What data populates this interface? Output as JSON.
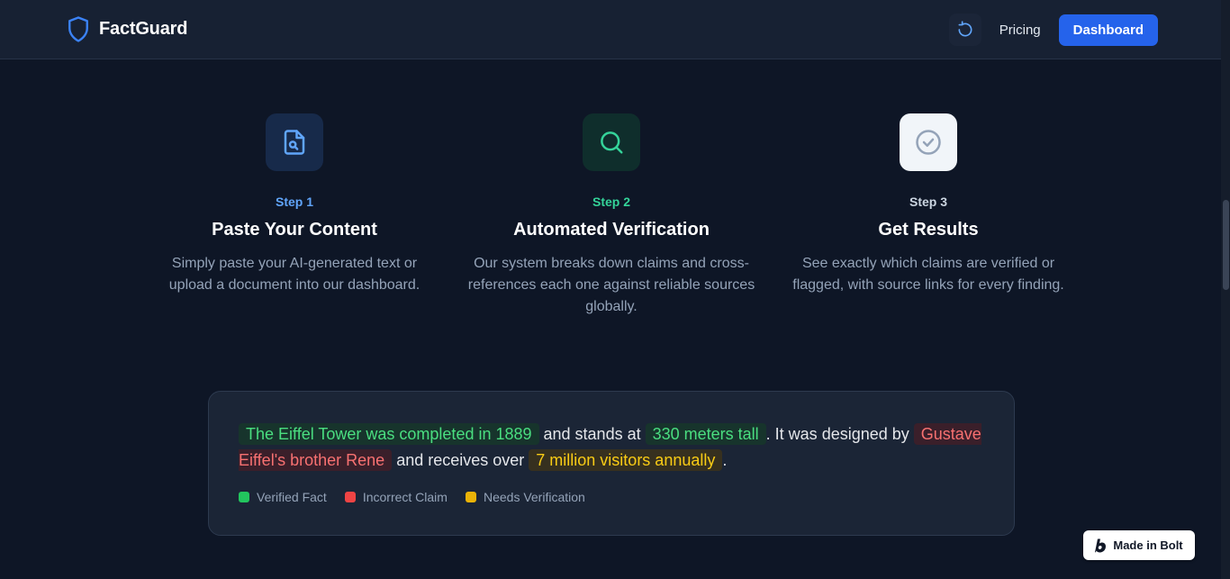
{
  "header": {
    "brand": "FactGuard",
    "pricing_label": "Pricing",
    "dashboard_label": "Dashboard"
  },
  "steps": [
    {
      "num": "Step 1",
      "title": "Paste Your Content",
      "desc": "Simply paste your AI-generated text or upload a document into our dashboard.",
      "icon": "file-search-icon",
      "accent": "#60a5fa"
    },
    {
      "num": "Step 2",
      "title": "Automated Verification",
      "desc": "Our system breaks down claims and cross-references each one against reliable sources globally.",
      "icon": "search-icon",
      "accent": "#34d399"
    },
    {
      "num": "Step 3",
      "title": "Get Results",
      "desc": "See exactly which claims are verified or flagged, with source links for every finding.",
      "icon": "check-circle-icon",
      "accent": "#cbd5e1"
    }
  ],
  "demo": {
    "seg1": "The Eiffel Tower was completed in 1889",
    "seg2": " and stands at ",
    "seg3": "330 meters tall",
    "seg4": ". It was designed by ",
    "seg5": "Gustave Eiffel's brother Rene",
    "seg6": " and receives over ",
    "seg7": "7 million visitors annually",
    "seg8": ".",
    "legend": [
      {
        "label": "Verified Fact",
        "color": "#22c55e"
      },
      {
        "label": "Incorrect Claim",
        "color": "#ef4444"
      },
      {
        "label": "Needs Verification",
        "color": "#eab308"
      }
    ]
  },
  "badge": {
    "label": "Made in Bolt"
  },
  "colors": {
    "primary": "#2563eb",
    "background": "#0e1626",
    "header": "#172133"
  }
}
